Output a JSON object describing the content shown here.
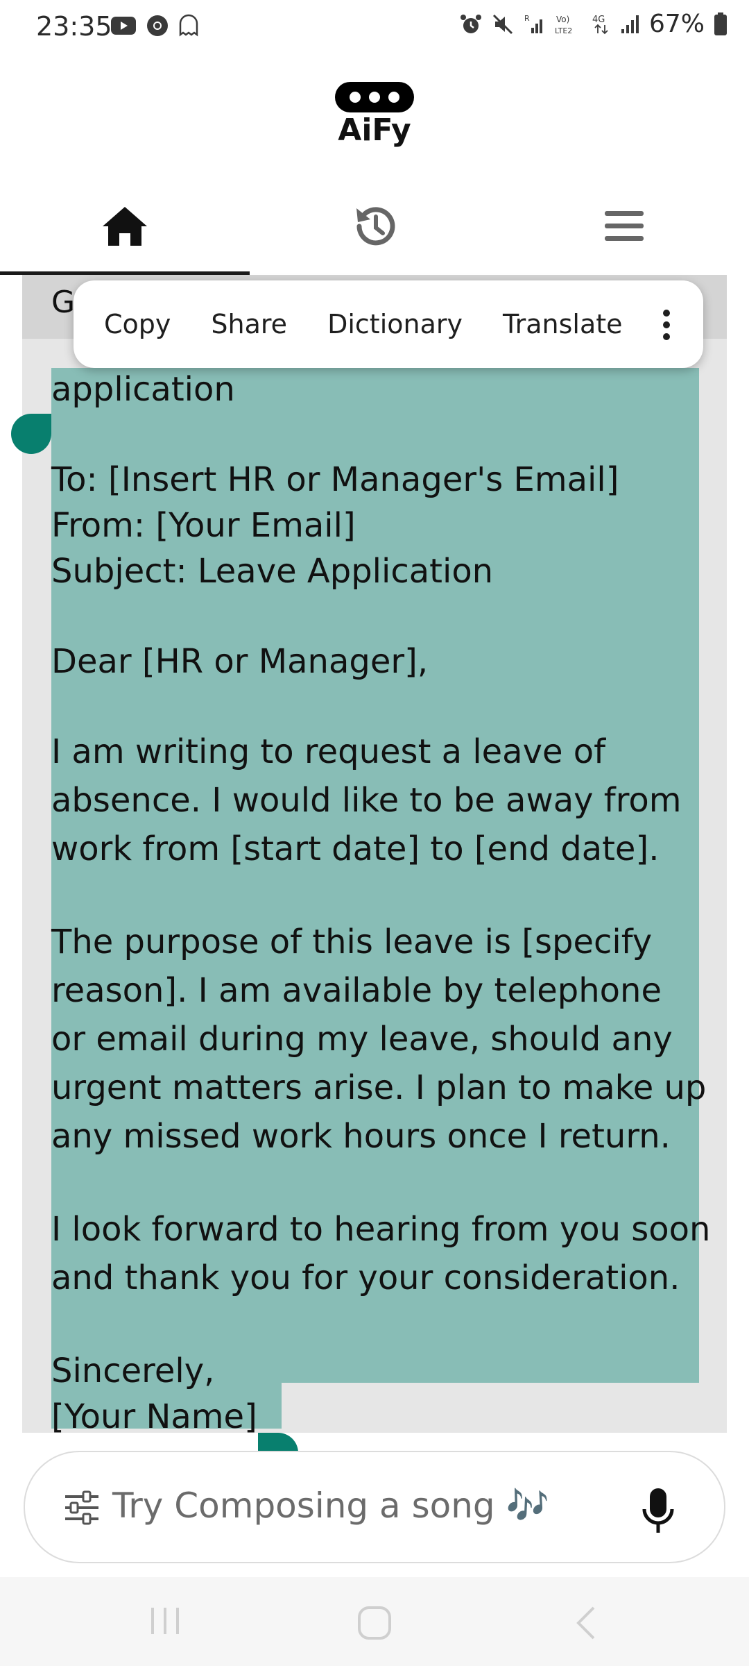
{
  "status_bar": {
    "time": "23:35",
    "battery_percent": "67%",
    "icons": [
      "youtube-icon",
      "chrome-icon",
      "ghost-icon",
      "alarm-icon",
      "mute-icon",
      "signal-r-icon",
      "volte-icon",
      "4g-icon",
      "signal-icon",
      "battery-icon"
    ]
  },
  "header": {
    "logo_text": "AiFy"
  },
  "tabs": [
    {
      "name": "home",
      "icon": "home-icon",
      "active": true
    },
    {
      "name": "history",
      "icon": "history-icon",
      "active": false
    },
    {
      "name": "menu",
      "icon": "menu-icon",
      "active": false
    }
  ],
  "card": {
    "header_text": "G"
  },
  "context_menu": {
    "items": [
      "Copy",
      "Share",
      "Dictionary",
      "Translate"
    ],
    "more_icon": "more-vert-icon"
  },
  "letter": {
    "lines": [
      "application",
      "",
      "To: [Insert HR or Manager's Email]",
      "From: [Your Email]",
      "Subject: Leave Application",
      "",
      "Dear [HR or Manager],",
      "",
      "I am writing to request a leave of",
      "absence. I would like to be away from",
      "work from [start date] to [end date].",
      "",
      "The purpose of this leave is [specify",
      "reason]. I am available by telephone",
      "or email during my leave, should any",
      "urgent matters arise. I plan to make up",
      "any missed work hours once I return.",
      "",
      "I look forward to hearing from you soon",
      "and thank you for your consideration.",
      "",
      "Sincerely,",
      "[Your Name]"
    ]
  },
  "input": {
    "placeholder": "Try Composing a song 🎶"
  },
  "colors": {
    "selection": "#88bdb6",
    "handle": "#087f6e",
    "card_bg": "#e6e6e6",
    "card_head": "#d4d4d4"
  }
}
